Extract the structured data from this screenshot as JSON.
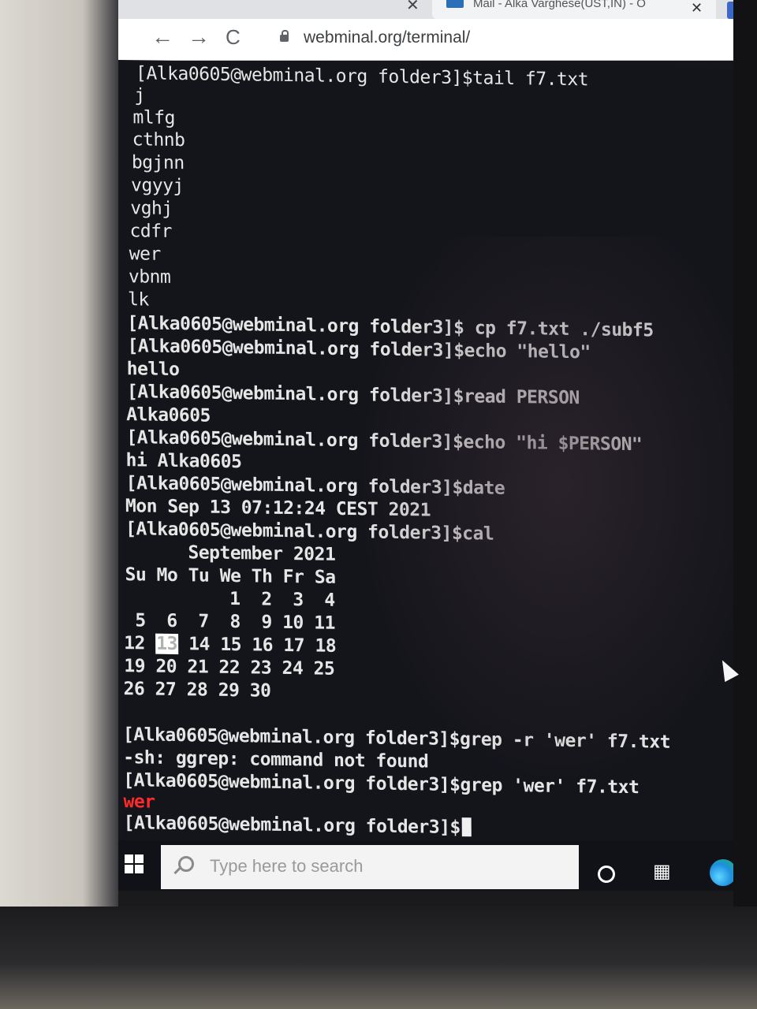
{
  "browser": {
    "tab": {
      "title": "Mail - Alka Varghese(UST,IN) - O",
      "close_glyph": "✕",
      "prev_close_glyph": "✕"
    },
    "nav": {
      "back_glyph": "←",
      "forward_glyph": "→",
      "reload_glyph": "C"
    },
    "url": "webminal.org/terminal/"
  },
  "terminal": {
    "prompt": "[Alka0605@webminal.org folder3]$",
    "lines": [
      "[Alka0605@webminal.org folder3]$tail f7.txt",
      "j",
      "mlfg",
      "cthnb",
      "bgjnn",
      "vgyyj",
      "vghj",
      "cdfr",
      "wer",
      "vbnm",
      "lk",
      "[Alka0605@webminal.org folder3]$ cp f7.txt ./subf5",
      "[Alka0605@webminal.org folder3]$echo \"hello\"",
      "hello",
      "[Alka0605@webminal.org folder3]$read PERSON",
      "Alka0605",
      "[Alka0605@webminal.org folder3]$echo \"hi $PERSON\"",
      "hi Alka0605",
      "[Alka0605@webminal.org folder3]$date",
      "Mon Sep 13 07:12:24 CEST 2021",
      "[Alka0605@webminal.org folder3]$cal",
      "      September 2021",
      "Su Mo Tu We Th Fr Sa",
      "          1  2  3  4",
      " 5  6  7  8  9 10 11",
      "12 ",
      "19 20 21 22 23 24 25",
      "26 27 28 29 30",
      "",
      "[Alka0605@webminal.org folder3]$grep -r 'wer' f7.txt",
      "-sh: ggrep: command not found",
      "[Alka0605@webminal.org folder3]$grep 'wer' f7.txt",
      "wer",
      "[Alka0605@webminal.org folder3]$"
    ],
    "calendar_today": "13",
    "calendar_row_rest": " 14 15 16 17 18",
    "grep_match_color": "#ff2b2b",
    "text_color": "#e6e6e6",
    "background": "#14151b"
  },
  "taskbar": {
    "search_placeholder": "Type here to search",
    "icons": [
      "windows-start-icon",
      "search-icon",
      "cortana-icon",
      "task-view-icon",
      "edge-icon"
    ]
  }
}
